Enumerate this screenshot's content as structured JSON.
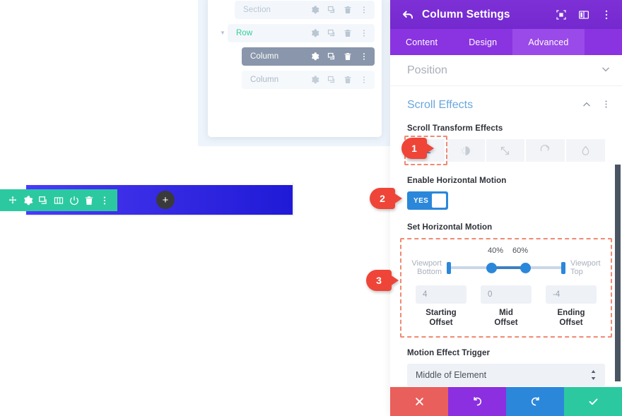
{
  "canvas": {
    "section_toolbar": {
      "icons": [
        {
          "name": "move-icon",
          "label": "Move"
        },
        {
          "name": "gear-icon",
          "label": "Settings"
        },
        {
          "name": "duplicate-icon",
          "label": "Duplicate"
        },
        {
          "name": "columns-icon",
          "label": "Columns"
        },
        {
          "name": "power-icon",
          "label": "Disable"
        },
        {
          "name": "trash-icon",
          "label": "Delete"
        },
        {
          "name": "more-vertical-icon",
          "label": "More options"
        }
      ]
    },
    "add_module_label": "+"
  },
  "layers": {
    "rows": [
      {
        "label": "Section",
        "type": "section",
        "state": "dim",
        "has_caret": false
      },
      {
        "label": "Row",
        "type": "row",
        "state": "normal",
        "has_caret": true
      },
      {
        "label": "Column",
        "type": "column",
        "state": "selected",
        "has_caret": false
      },
      {
        "label": "Column",
        "type": "column",
        "state": "dim",
        "has_caret": false
      }
    ],
    "row_actions": [
      {
        "name": "gear-icon"
      },
      {
        "name": "duplicate-icon"
      },
      {
        "name": "trash-icon"
      },
      {
        "name": "more-vertical-icon"
      }
    ]
  },
  "modal": {
    "header": {
      "back_icon": "back-arrow-icon",
      "title": "Column Settings",
      "icons": [
        {
          "name": "expand-view-icon"
        },
        {
          "name": "split-view-icon"
        },
        {
          "name": "more-vertical-icon"
        }
      ]
    },
    "tabs": [
      {
        "label": "Content",
        "active": false
      },
      {
        "label": "Design",
        "active": false
      },
      {
        "label": "Advanced",
        "active": true
      }
    ],
    "position_section": {
      "title": "Position",
      "chevron": "chevron-down-icon"
    },
    "scroll_effects": {
      "title": "Scroll Effects",
      "collapse_icon": "chevron-up-icon",
      "more_icon": "more-vertical-icon",
      "transform_label": "Scroll Transform Effects",
      "effects": [
        {
          "name": "horizontal-motion-icon",
          "label": "Horizontal Motion",
          "active": true
        },
        {
          "name": "vertical-motion-icon",
          "label": "Vertical Motion",
          "active": false
        },
        {
          "name": "scaling-icon",
          "label": "Scaling Up/Down",
          "active": false
        },
        {
          "name": "rotating-icon",
          "label": "Rotating",
          "active": false
        },
        {
          "name": "fading-icon",
          "label": "Fading In/Out",
          "active": false
        }
      ],
      "enable_label": "Enable Horizontal Motion",
      "enable_value": "YES",
      "set_motion_label": "Set Horizontal Motion",
      "slider": {
        "left_label_line1": "Viewport",
        "left_label_line2": "Bottom",
        "right_label_line1": "Viewport",
        "right_label_line2": "Top",
        "mid_percent_start": "40%",
        "mid_percent_end": "60%"
      },
      "offsets": [
        {
          "value": "4",
          "name_line1": "Starting",
          "name_line2": "Offset"
        },
        {
          "value": "0",
          "name_line1": "Mid",
          "name_line2": "Offset"
        },
        {
          "value": "-4",
          "name_line1": "Ending",
          "name_line2": "Offset"
        }
      ],
      "trigger_label": "Motion Effect Trigger",
      "trigger_value": "Middle of Element"
    },
    "actions": [
      {
        "name": "cancel-button",
        "icon": "close-icon",
        "color": "#e95f5c"
      },
      {
        "name": "undo-button",
        "icon": "undo-icon",
        "color": "#8b2fe0"
      },
      {
        "name": "redo-button",
        "icon": "redo-icon",
        "color": "#2b87da"
      },
      {
        "name": "save-button",
        "icon": "checkmark-icon",
        "color": "#2cc9a0"
      }
    ]
  },
  "callouts": [
    {
      "number": "1"
    },
    {
      "number": "2"
    },
    {
      "number": "3"
    }
  ],
  "chart_data": {
    "type": "table",
    "title": "Set Horizontal Motion",
    "categories": [
      "Starting Offset",
      "Mid Offset",
      "Ending Offset"
    ],
    "values": [
      4,
      0,
      -4
    ],
    "x": [
      "0%",
      "40%",
      "60%",
      "100%"
    ],
    "xlabel": "Viewport position (Bottom to Top)",
    "ylabel": "Offset"
  }
}
